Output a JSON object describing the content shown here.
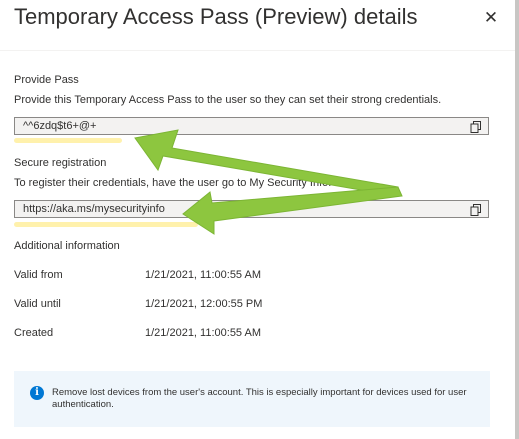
{
  "panel": {
    "title": "Temporary Access Pass (Preview) details",
    "close_glyph": "✕"
  },
  "provide_pass": {
    "label": "Provide Pass",
    "description": "Provide this Temporary Access Pass to the user so they can set their strong credentials.",
    "value": "^^6zdq$t6+@+"
  },
  "secure_registration": {
    "label": "Secure registration",
    "description": "To register their credentials, have the user go to My Security Info.",
    "value": "https://aka.ms/mysecurityinfo"
  },
  "additional_info": {
    "label": "Additional information",
    "rows": [
      {
        "label": "Valid from",
        "value": "1/21/2021, 11:00:55 AM"
      },
      {
        "label": "Valid until",
        "value": "1/21/2021, 12:00:55 PM"
      },
      {
        "label": "Created",
        "value": "1/21/2021, 11:00:55 AM"
      }
    ]
  },
  "info_banner": {
    "icon": "info-icon",
    "icon_glyph": "i",
    "text": "Remove lost devices from the user's account. This is especially important for devices used for user authentication."
  },
  "colors": {
    "accent": "#0078d4",
    "annotation_arrow": "#8dc63f",
    "annotation_highlight": "#fff0a8",
    "info_bg": "#eff6fc",
    "field_bg": "#f3f2f1"
  },
  "icons": {
    "copy": "copy-icon",
    "close": "close-icon"
  }
}
